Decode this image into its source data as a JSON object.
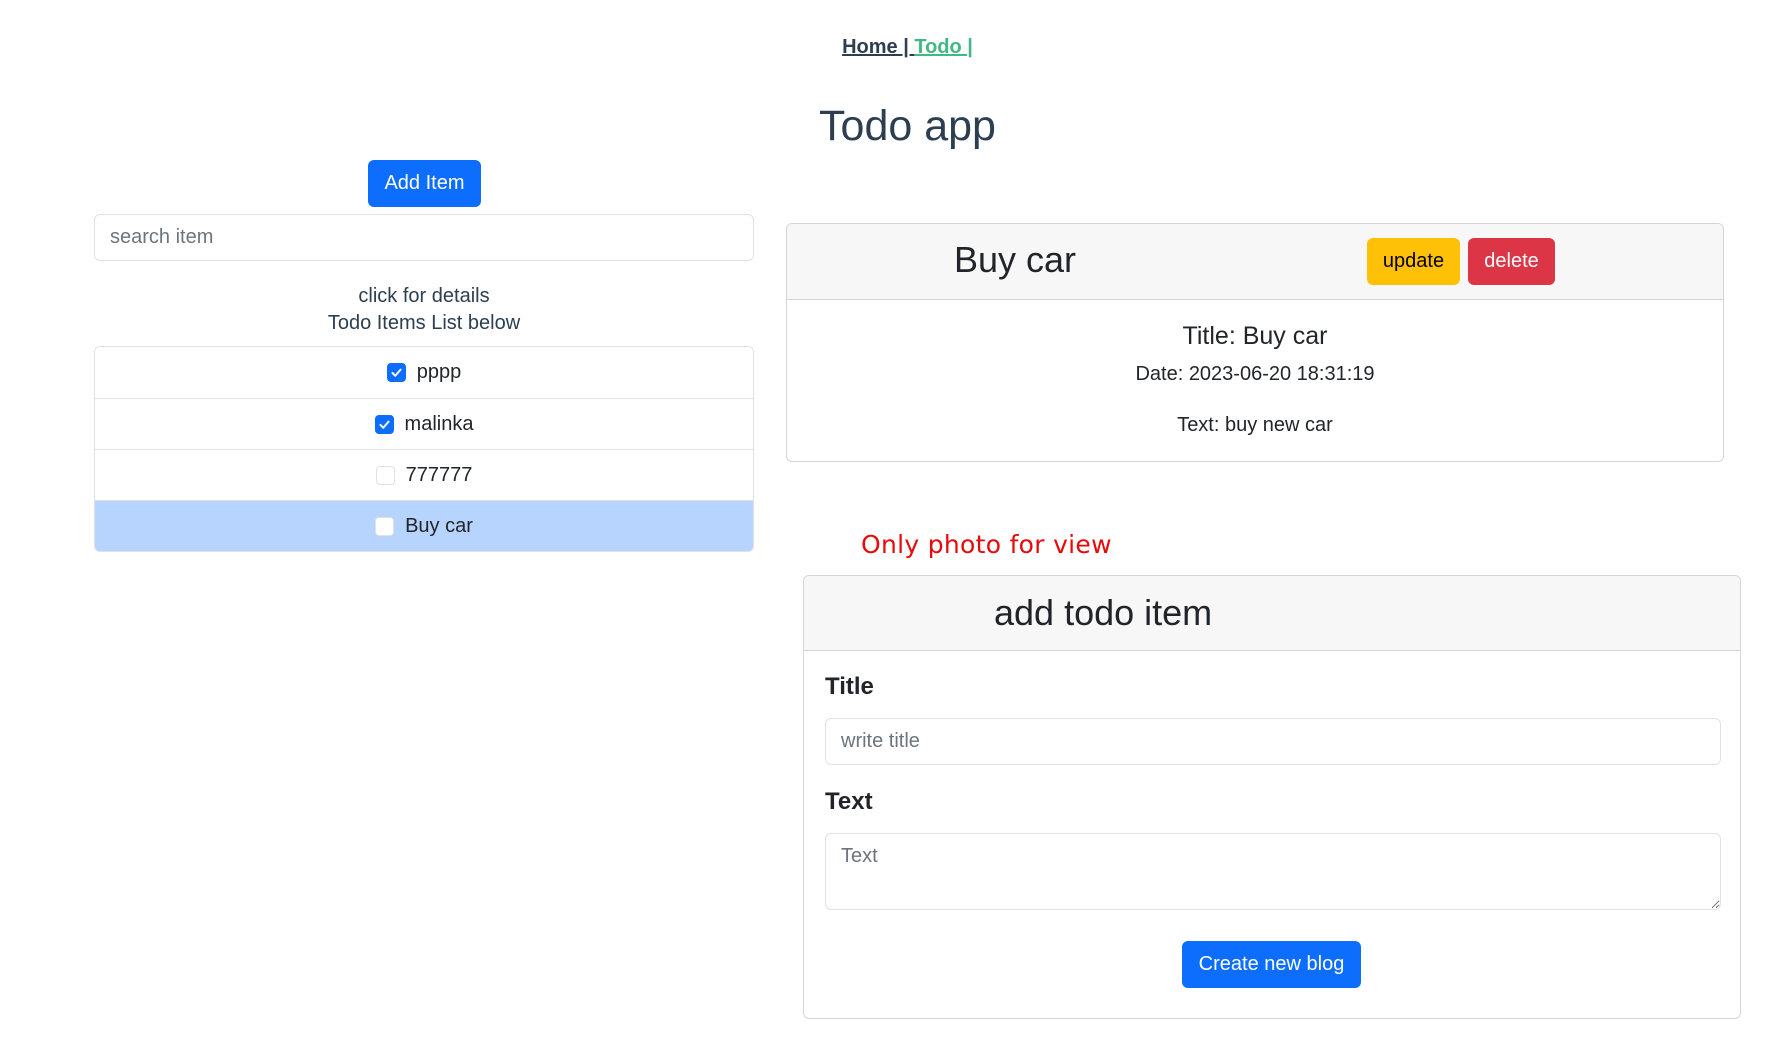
{
  "nav": {
    "home": "Home | ",
    "todo": " Todo |"
  },
  "app_title": "Todo app",
  "left": {
    "add_item_label": "Add Item",
    "search_placeholder": "search item",
    "caption_line1": "click for details",
    "caption_line2": "Todo Items List below",
    "items": [
      {
        "label": "pppp",
        "checked": true,
        "selected": false
      },
      {
        "label": "malinka",
        "checked": true,
        "selected": false
      },
      {
        "label": "777777",
        "checked": false,
        "selected": false
      },
      {
        "label": "Buy car",
        "checked": false,
        "selected": true
      }
    ]
  },
  "detail": {
    "header_title": "Buy car",
    "update_label": "update",
    "delete_label": "delete",
    "title_line": "Title: Buy car",
    "date_line": "Date: 2023-06-20 18:31:19",
    "text_line": "Text: buy new car"
  },
  "note": "Only photo for view",
  "add_form": {
    "header_title": "add todo item",
    "title_label": "Title",
    "title_placeholder": "write title",
    "text_label": "Text",
    "text_placeholder": "Text",
    "submit_label": "Create new blog"
  },
  "colors": {
    "primary": "#0d6efd",
    "warning": "#ffc107",
    "danger": "#dc3545",
    "nav_active": "#42b983",
    "selected_row": "#b6d4fe",
    "note_red": "#e8090a"
  }
}
